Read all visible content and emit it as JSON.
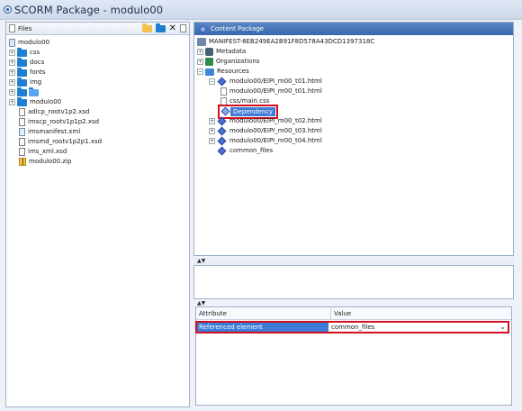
{
  "window": {
    "title": "SCORM Package - modulo00"
  },
  "files_pane": {
    "header_label": "Files",
    "tree": [
      {
        "label": "modulo00",
        "icon": "folder",
        "indent": 0,
        "expander": ""
      },
      {
        "label": "css",
        "icon": "folder",
        "indent": 0,
        "expander": "+"
      },
      {
        "label": "docs",
        "icon": "folder",
        "indent": 0,
        "expander": "+"
      },
      {
        "label": "fonts",
        "icon": "folder",
        "indent": 0,
        "expander": "+"
      },
      {
        "label": "img",
        "icon": "folder",
        "indent": 0,
        "expander": "+"
      },
      {
        "label": "",
        "icon": "folder-open",
        "indent": 0,
        "expander": "+"
      },
      {
        "label": "modulo00",
        "icon": "folder",
        "indent": 0,
        "expander": "+"
      },
      {
        "label": "adlcp_rootv1p2.xsd",
        "icon": "xsd",
        "indent": 1,
        "expander": ""
      },
      {
        "label": "imscp_rootv1p1p2.xsd",
        "icon": "xsd",
        "indent": 1,
        "expander": ""
      },
      {
        "label": "imsmanifest.xml",
        "icon": "xml",
        "indent": 1,
        "expander": ""
      },
      {
        "label": "imsmd_rootv1p2p1.xsd",
        "icon": "xsd",
        "indent": 1,
        "expander": ""
      },
      {
        "label": "ims_xml.xsd",
        "icon": "xsd",
        "indent": 1,
        "expander": ""
      },
      {
        "label": "modulo00.zip",
        "icon": "zip",
        "indent": 1,
        "expander": ""
      }
    ]
  },
  "content_package": {
    "header_label": "Content Package",
    "manifest_id": "MANIFEST-8EB249EA2B91F8D578A43DCD1397318C",
    "metadata_label": "Metadata",
    "organizations_label": "Organizations",
    "resources_label": "Resources",
    "resource_1": "modulo00/EIPI_m00_t01.html",
    "resource_1_file": "modulo00/EIPI_m00_t01.html",
    "resource_1_css": "css/main.css",
    "dependency_label": "Dependency",
    "resource_2": "modulo00/EIPI_m00_t02.html",
    "resource_3": "modulo00/EIPI_m00_t03.html",
    "resource_4": "modulo00/EIPI_m00_t04.html",
    "common_files": "common_files"
  },
  "properties": {
    "col_attribute": "Attribute",
    "col_value": "Value",
    "row_attribute": "Referenced element",
    "row_value": "common_files"
  },
  "icons": {
    "toolbar": [
      "open-folder-icon",
      "new-folder-icon",
      "delete-icon",
      "settings-icon"
    ]
  },
  "colors": {
    "accent": "#3d7bd6",
    "highlight_outline": "#d20f1f"
  }
}
